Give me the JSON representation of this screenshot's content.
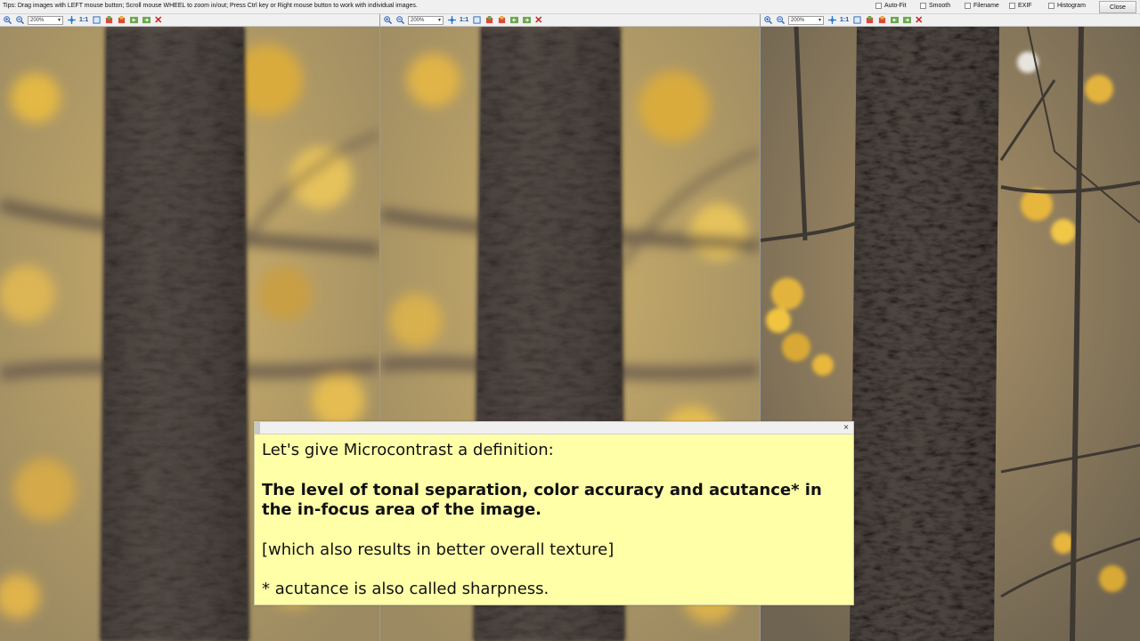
{
  "topbar": {
    "tips": "Tips: Drag images with LEFT mouse button; Scroll mouse WHEEL to zoom in/out; Press Ctrl key or Right mouse button to work with individual images.",
    "options": [
      {
        "label": "Auto-Fit",
        "checked": false
      },
      {
        "label": "Smooth",
        "checked": false
      },
      {
        "label": "Filename",
        "checked": false
      },
      {
        "label": "EXIF",
        "checked": false
      },
      {
        "label": "Histogram",
        "checked": false
      }
    ],
    "close_label": "Close"
  },
  "panels": [
    {
      "zoom": "200%",
      "one_to_one": "1:1"
    },
    {
      "zoom": "200%",
      "one_to_one": "1:1"
    },
    {
      "zoom": "200%",
      "one_to_one": "1:1"
    }
  ],
  "note": {
    "line1": "Let's give Microcontrast a definition:",
    "definition": "The level of tonal separation, color accuracy and acutance* in the in-focus area of the image.",
    "bracket": "[which also results in better overall texture]",
    "footnote": "* acutance is also called sharpness.",
    "close_glyph": "×"
  },
  "colors": {
    "bokeh_bg": "#b89a55",
    "bark": "#4a4340",
    "note_bg": "#ffffa8",
    "red_x": "#d21b1b"
  }
}
